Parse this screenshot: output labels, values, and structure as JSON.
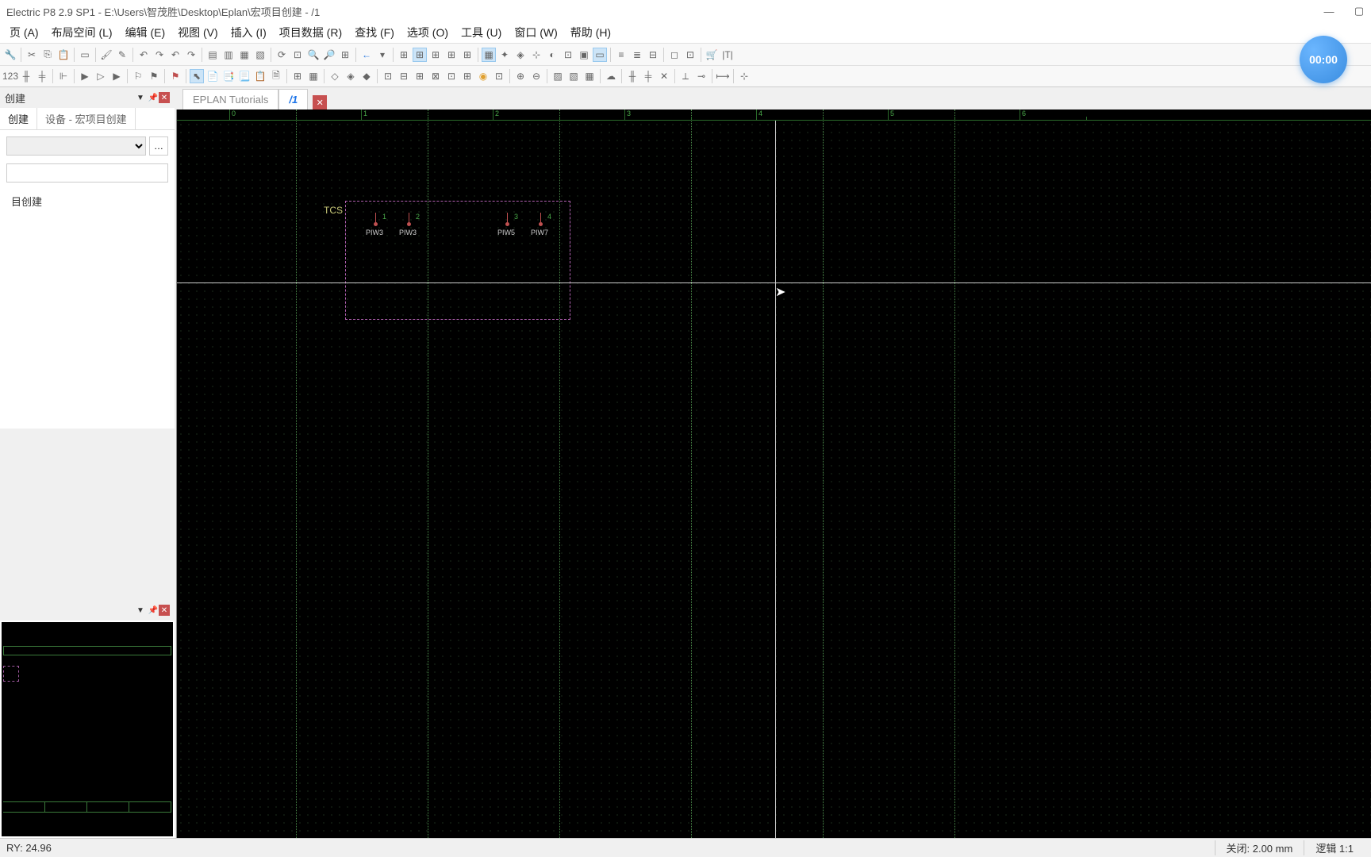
{
  "title": "Electric P8 2.9 SP1 - E:\\Users\\智茂胜\\Desktop\\Eplan\\宏项目创建 - /1",
  "menu": [
    "页 (A)",
    "布局空间 (L)",
    "编辑 (E)",
    "视图 (V)",
    "插入 (I)",
    "项目数据 (R)",
    "查找 (F)",
    "选项 (O)",
    "工具 (U)",
    "窗口 (W)",
    "帮助 (H)"
  ],
  "timer": "00:00",
  "left_panel": {
    "title": "创建",
    "tabs": [
      "创建",
      "设备 - 宏项目创建"
    ],
    "tree_root": "目创建"
  },
  "doc_tabs": {
    "main": "EPLAN Tutorials",
    "page": "/1"
  },
  "ruler_labels": [
    "0",
    "1",
    "2",
    "3",
    "4",
    "5",
    "6"
  ],
  "component": {
    "label": "TCS",
    "pins": [
      {
        "num": "1",
        "name": "PIW3"
      },
      {
        "num": "2",
        "name": "PIW3"
      },
      {
        "num": "3",
        "name": "PIW5"
      },
      {
        "num": "4",
        "name": "PIW7"
      }
    ]
  },
  "status": {
    "coord": "RY: 24.96",
    "grid": "关闭: 2.00 mm",
    "zoom": "逻辑 1:1"
  }
}
